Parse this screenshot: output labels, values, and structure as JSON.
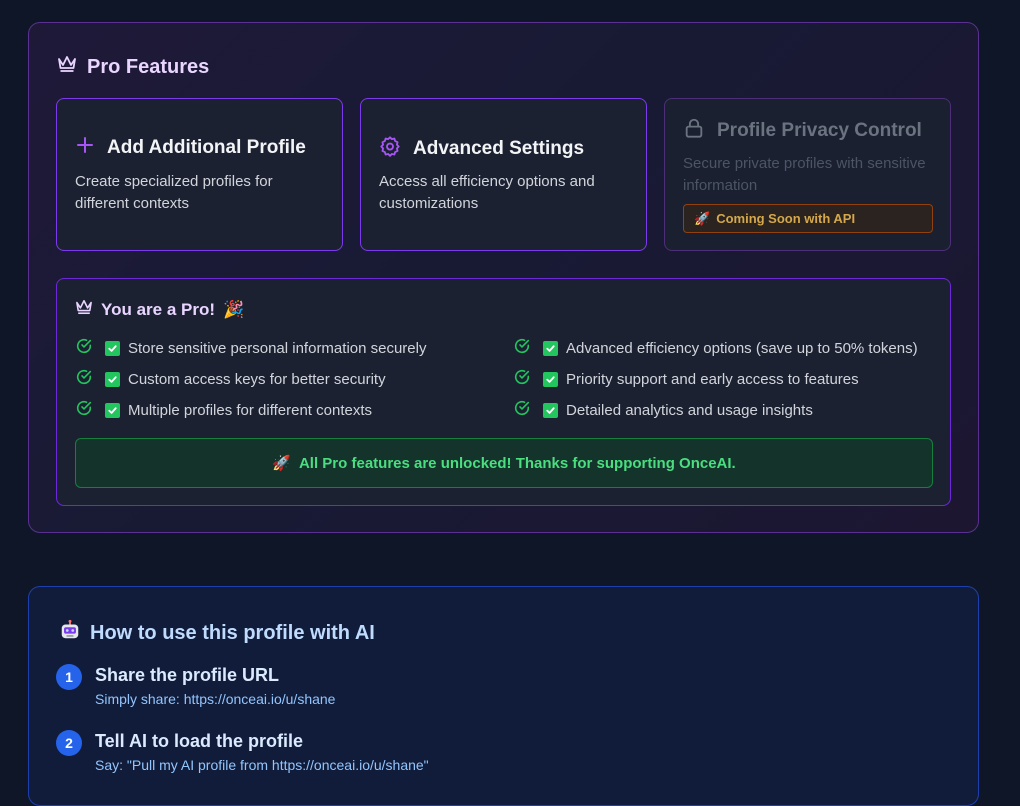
{
  "pro_features": {
    "title": "Pro Features",
    "cards": [
      {
        "title": "Add Additional Profile",
        "desc": "Create specialized profiles for different contexts"
      },
      {
        "title": "Advanced Settings",
        "desc": "Access all efficiency options and customizations"
      },
      {
        "title": "Profile Privacy Control",
        "desc": "Secure private profiles with sensitive information",
        "badge": "Coming Soon with API"
      }
    ]
  },
  "you_pro": {
    "title": "You are a Pro!",
    "features": [
      "Store sensitive personal information securely",
      "Advanced efficiency options (save up to 50% tokens)",
      "Custom access keys for better security",
      "Priority support and early access to features",
      "Multiple profiles for different contexts",
      "Detailed analytics and usage insights"
    ],
    "unlocked_message": "All Pro features are unlocked! Thanks for supporting OnceAI."
  },
  "how_to": {
    "title": "How to use this profile with AI",
    "steps": [
      {
        "num": "1",
        "title": "Share the profile URL",
        "desc": "Simply share: https://onceai.io/u/shane"
      },
      {
        "num": "2",
        "title": "Tell AI to load the profile",
        "desc": "Say: \"Pull my AI profile from https://onceai.io/u/shane\""
      }
    ]
  },
  "colors": {
    "accent_purple": "#a855f7",
    "success_green": "#22c55e",
    "step_blue": "#2563eb",
    "badge_amber": "#d4a84b"
  }
}
